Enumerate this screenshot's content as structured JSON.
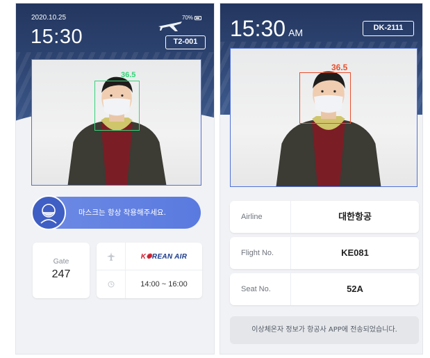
{
  "left": {
    "date": "2020.10.25",
    "time": "15:30",
    "battery": "70%",
    "terminal_code": "T2-001",
    "temperature": "36.5",
    "notice": "마스크는 항상 착용해주세요.",
    "gate": {
      "label": "Gate",
      "value": "247"
    },
    "airline_logo": {
      "prefix": "K",
      "star": "✺",
      "name": "REAN AIR"
    },
    "schedule": "14:00 ~ 16:00"
  },
  "right": {
    "time": "15:30",
    "ampm": "AM",
    "flight_code": "DK-2111",
    "temperature": "36.5",
    "rows": [
      {
        "label": "Airline",
        "value": "대한항공"
      },
      {
        "label": "Flight No.",
        "value": "KE081"
      },
      {
        "label": "Seat No.",
        "value": "52A"
      }
    ],
    "footnote": "이상체온자 정보가 항공사 APP에 전송되었습니다."
  },
  "colors": {
    "header": "#2e4572",
    "accent_blue": "#5a7ae0",
    "temp_normal": "#37d27a",
    "temp_alert": "#e8502d"
  },
  "icons": [
    "airplane-icon",
    "battery-icon",
    "mask-icon",
    "airport-icon",
    "clock-icon"
  ]
}
